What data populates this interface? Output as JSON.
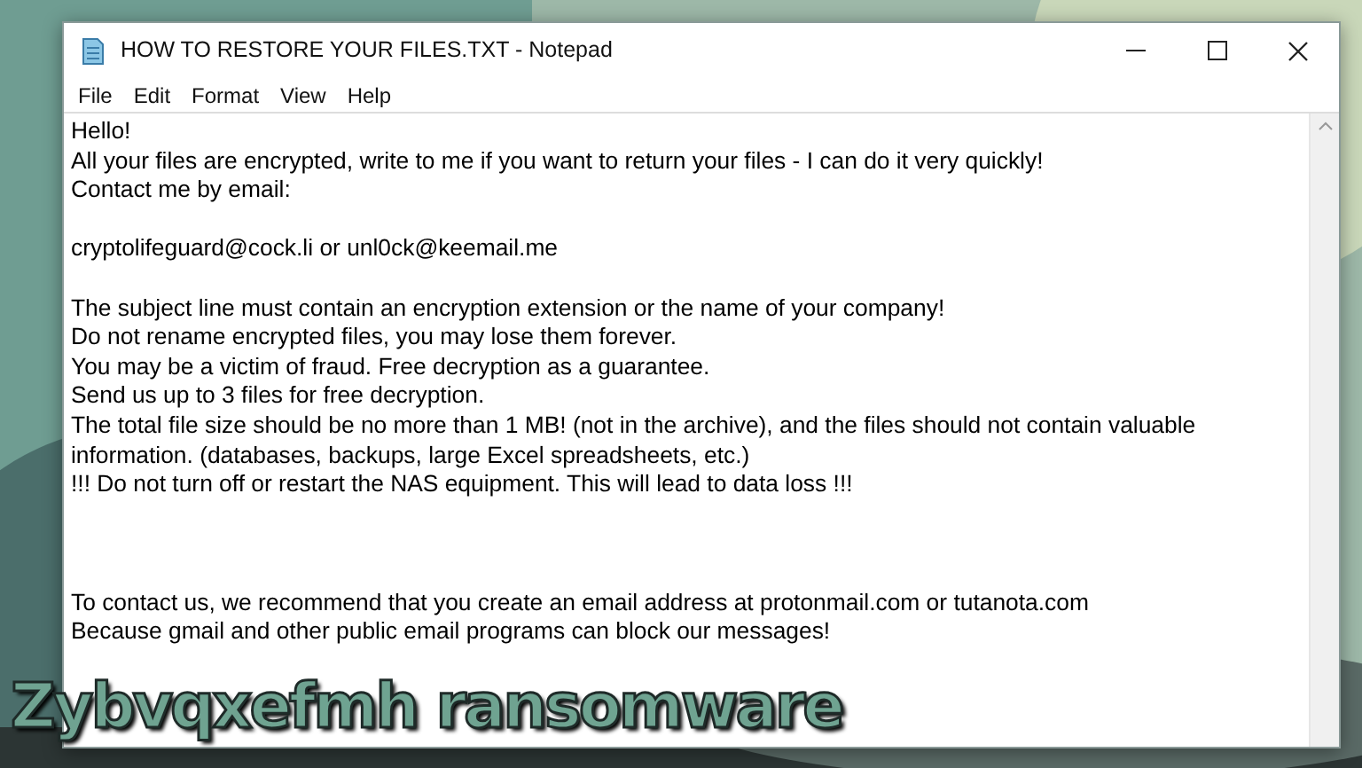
{
  "window": {
    "title": "HOW TO RESTORE YOUR FILES.TXT - Notepad"
  },
  "menu": [
    "File",
    "Edit",
    "Format",
    "View",
    "Help"
  ],
  "document": [
    {
      "kind": "text",
      "text": "Hello!"
    },
    {
      "kind": "text",
      "text": "All your files are encrypted, write to me if you want to return your files - I can do it very quickly!"
    },
    {
      "kind": "text",
      "text": "Contact me by email:"
    },
    {
      "kind": "blank"
    },
    {
      "kind": "text",
      "text": "cryptolifeguard@cock.li or unl0ck@keemail.me"
    },
    {
      "kind": "blank"
    },
    {
      "kind": "text",
      "text": "The subject line must contain an encryption extension or the name of your company!"
    },
    {
      "kind": "text",
      "text": "Do not rename encrypted files, you may lose them forever."
    },
    {
      "kind": "text",
      "text": "You may be a victim of fraud. Free decryption as a guarantee."
    },
    {
      "kind": "text",
      "text": "Send us up to 3 files for free decryption."
    },
    {
      "kind": "text",
      "text": "The total file size should be no more than 1 MB! (not in the archive), and the files should not contain valuable"
    },
    {
      "kind": "text",
      "text": "information. (databases, backups, large Excel spreadsheets, etc.)"
    },
    {
      "kind": "text",
      "text": "!!! Do not turn off or restart the NAS equipment. This will lead to data loss !!!"
    },
    {
      "kind": "blank"
    },
    {
      "kind": "blank"
    },
    {
      "kind": "blank"
    },
    {
      "kind": "text",
      "text": "To contact us, we recommend that you create an email address at protonmail.com or tutanota.com"
    },
    {
      "kind": "text",
      "text": "Because gmail and other public email programs can block our messages!"
    }
  ],
  "caption": "Zybvqxefmh ransomware"
}
